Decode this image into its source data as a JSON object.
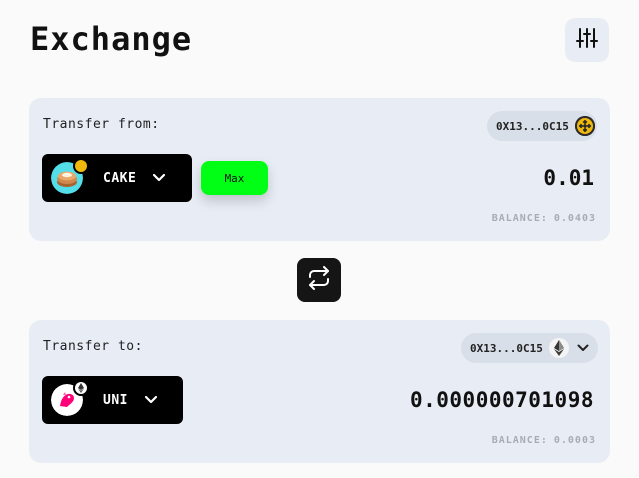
{
  "title": "Exchange",
  "icons": {
    "settings": "sliders-icon",
    "swap": "swap-arrows-icon",
    "chevron": "chevron-down-icon"
  },
  "colors": {
    "accent": "#00ff14",
    "panel": "#e8edf5",
    "token_button": "#000000",
    "balance_text": "#a6acb6"
  },
  "from": {
    "label": "Transfer from:",
    "address": "0X13...0C15",
    "network_icon": "bnb-chain-icon",
    "token": {
      "symbol": "CAKE",
      "icon": "cake-token-icon",
      "badge_icon": "bnb-chain-icon"
    },
    "max_label": "Max",
    "amount": "0.01",
    "balance_label": "BALANCE:",
    "balance_value": "0.0403"
  },
  "to": {
    "label": "Transfer to:",
    "address": "0X13...0C15",
    "network_icon": "ethereum-icon",
    "token": {
      "symbol": "UNI",
      "icon": "uni-token-icon",
      "badge_icon": "ethereum-icon"
    },
    "amount": "0.000000701098",
    "balance_label": "BALANCE:",
    "balance_value": "0.0003"
  }
}
